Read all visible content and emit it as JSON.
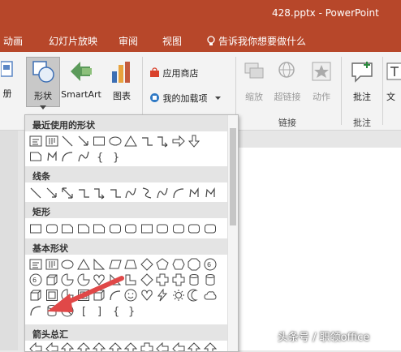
{
  "window": {
    "title": "428.pptx - PowerPoint"
  },
  "tabs": [
    "动画",
    "幻灯片放映",
    "审阅",
    "视图"
  ],
  "tell_me": "告诉我你想要做什么",
  "ribbon": {
    "partial_left_label": "册",
    "shapes_label": "形状",
    "smartart_label": "SmartArt",
    "chart_label": "图表",
    "store_label": "应用商店",
    "my_addins_label": "我的加载项",
    "zoom_label": "缩放",
    "hyperlink_label": "超链接",
    "action_label": "动作",
    "comment_label": "批注",
    "partial_right_label": "文",
    "group_links": "链接",
    "group_comments": "批注"
  },
  "shapes_panel": {
    "sections": [
      "最近使用的形状",
      "线条",
      "矩形",
      "基本形状",
      "箭头总汇"
    ]
  },
  "watermark": "头条号 / 职领office",
  "colors": {
    "accent": "#b7472a",
    "arrow": "#e04848"
  }
}
